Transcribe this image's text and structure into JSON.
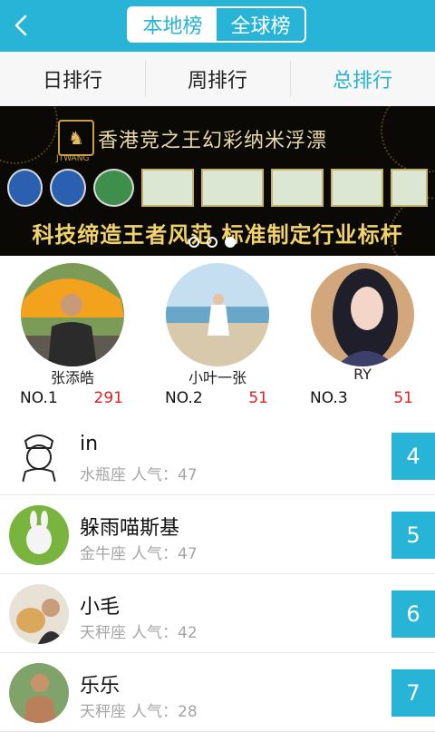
{
  "header": {
    "back_icon": "chevron-left-icon",
    "segment": {
      "local": "本地榜",
      "global": "全球榜",
      "selected": "local"
    }
  },
  "tabs": {
    "items": [
      {
        "label": "日排行"
      },
      {
        "label": "周排行"
      },
      {
        "label": "总排行"
      }
    ],
    "active_index": 2
  },
  "banner": {
    "title": "香港竞之王幻彩纳米浮漂",
    "slogan": "科技缔造王者风范 标准制定行业标杆",
    "logo_text": "JTWANG",
    "pager": {
      "count": 3,
      "active": 3
    }
  },
  "top3": [
    {
      "name": "张添皓",
      "rank": "NO.1",
      "score": "291"
    },
    {
      "name": "小叶一张",
      "rank": "NO.2",
      "score": "51"
    },
    {
      "name": "RY",
      "rank": "NO.3",
      "score": "51"
    }
  ],
  "list": [
    {
      "name": "in",
      "zodiac": "水瓶座",
      "popularity_label": "人气：",
      "popularity": "47",
      "rank": "4"
    },
    {
      "name": "躲雨喵斯基",
      "zodiac": "金牛座",
      "popularity_label": "人气：",
      "popularity": "47",
      "rank": "5"
    },
    {
      "name": "小毛",
      "zodiac": "天秤座",
      "popularity_label": "人气：",
      "popularity": "42",
      "rank": "6"
    },
    {
      "name": "乐乐",
      "zodiac": "天秤座",
      "popularity_label": "人气：",
      "popularity": "28",
      "rank": "7"
    }
  ],
  "colors": {
    "accent": "#27b4d6",
    "score": "#e02020",
    "muted": "#a5a5a5"
  }
}
